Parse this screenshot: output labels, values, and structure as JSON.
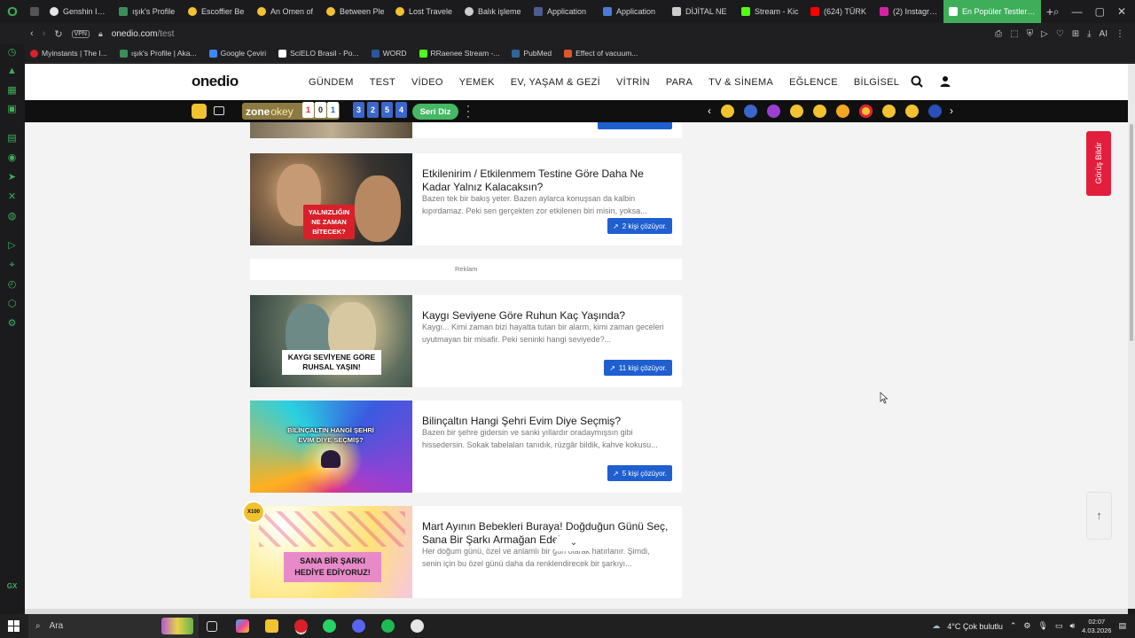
{
  "browser": {
    "tabs": [
      {
        "label": "",
        "color": "#555"
      },
      {
        "label": "Genshin Imp",
        "color": "#e6e6e6"
      },
      {
        "label": "ışık's Profile",
        "color": "#3b8e5a"
      },
      {
        "label": "Escoffier Be",
        "color": "#f2c230"
      },
      {
        "label": "An Omen of",
        "color": "#f2c230"
      },
      {
        "label": "Between Ple",
        "color": "#f2c230"
      },
      {
        "label": "Lost Travele",
        "color": "#f2c230"
      },
      {
        "label": "Balık işleme",
        "color": "#cccccc"
      },
      {
        "label": "Application",
        "color": "#4b5e8f"
      },
      {
        "label": "Application",
        "color": "#4b7bd6"
      },
      {
        "label": "DİJİTAL NE",
        "color": "#cccccc"
      },
      {
        "label": "Stream - Kic",
        "color": "#53fc18"
      },
      {
        "label": "(624) TÜRK",
        "color": "#ff0000"
      },
      {
        "label": "(2) Instagran",
        "color": "#d6249f"
      }
    ],
    "active_tab": "En Popüler Testler ve T",
    "new_tab": "+",
    "url_host": "onedio.com",
    "url_path": "/test",
    "vpn": "VPN",
    "ai_label": "AI",
    "bookmarks": [
      {
        "label": "Myinstants | The I...",
        "color": "#d4242a"
      },
      {
        "label": "ışık's Profile | Aka...",
        "color": "#3b8e5a"
      },
      {
        "label": "Google Çeviri",
        "color": "#4285f4"
      },
      {
        "label": "SciELO Brasil - Po...",
        "color": "#ffffff"
      },
      {
        "label": "WORD",
        "color": "#2b579a"
      },
      {
        "label": "RRaenee Stream -...",
        "color": "#53fc18"
      },
      {
        "label": "PubMed",
        "color": "#326599"
      },
      {
        "label": "Effect of vacuum...",
        "color": "#e0572a"
      }
    ]
  },
  "site": {
    "logo": "onedio",
    "nav": [
      "GÜNDEM",
      "TEST",
      "VİDEO",
      "YEMEK",
      "EV, YAŞAM & GEZİ",
      "VİTRİN",
      "PARA",
      "TV & SİNEMA",
      "EĞLENCE",
      "BİLGİSEL"
    ],
    "zone_label": "zone",
    "okey_label": "okey",
    "okey_tiles": [
      "1",
      "0",
      "1"
    ],
    "number_tiles": [
      "3",
      "2",
      "5",
      "4"
    ],
    "seri_diz": "Seri Diz",
    "ad_label": "Reklam",
    "feedback": "Görüş Bildir"
  },
  "cards": [
    {
      "title": "Etkilenirim / Etkilenmem Testine Göre Daha Ne Kadar Yalnız Kalacaksın?",
      "description": "Bazen tek bir bakış yeter. Bazen aylarca konuşsan da kalbin kıpırdamaz. Peki sen gerçekten zor etkilenen biri misin, yoksa...",
      "solvers": "2 kişi çözüyor.",
      "thumb_text": "YALNIZLIĞIN NE ZAMAN BİTECEK?"
    },
    {
      "title": "Kaygı Seviyene Göre Ruhun Kaç Yaşında?",
      "description": "Kaygı... Kimi zaman bizi hayatta tutan bir alarm, kimi zaman geceleri uyutmayan bir misafir. Peki seninki hangi seviyede?...",
      "solvers": "11 kişi çözüyor.",
      "thumb_text": "KAYGI SEVİYENE GÖRE RUHSAL YAŞIN!"
    },
    {
      "title": "Bilinçaltın Hangi Şehri Evim Diye Seçmiş?",
      "description": "Bazen bir şehre gidersin ve sanki yıllardır oradaymışsın gibi hissedersin. Sokak tabelaları tanıdık, rüzgâr bildik, kahve kokusu...",
      "solvers": "5 kişi çözüyor.",
      "thumb_text": "BİLİNÇALTIN HANGİ ŞEHRİ EVİM DİYE SEÇMİŞ?"
    },
    {
      "title": "Mart Ayının Bebekleri Buraya! Doğduğun Günü Seç, Sana Bir Şarkı Armağan Edelim!",
      "description": "Her doğum günü, özel ve anlamlı bir gün olarak hatırlanır. Şimdi, senin için bu özel günü daha da renklendirecek bir şarkıyı...",
      "solvers": "",
      "thumb_text": "SANA BİR ŞARKI HEDİYE EDİYORUZ!",
      "badge": "X100"
    }
  ],
  "taskbar": {
    "search_placeholder": "Ara",
    "weather": "4°C  Çok bulutlu",
    "time": "02:07",
    "date": "4.03.2026"
  },
  "colors": {
    "accent_green": "#3fae5a",
    "solve_blue": "#1f5fd0",
    "feedback_red": "#e31e3c"
  }
}
